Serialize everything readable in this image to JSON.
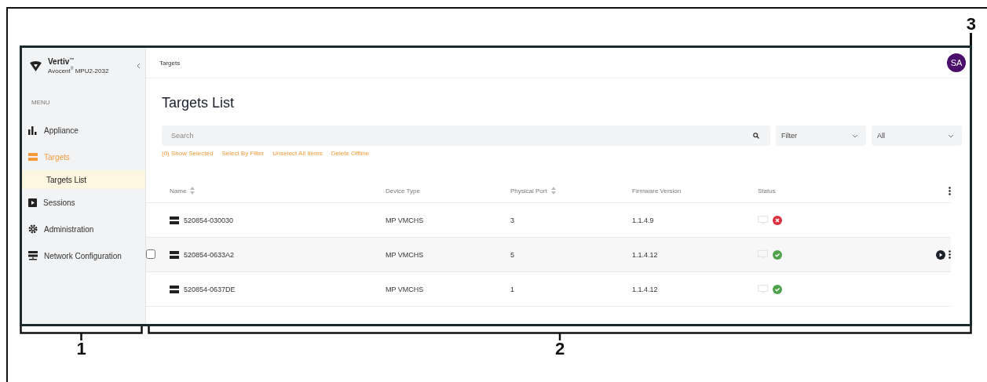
{
  "sidebar": {
    "brand": "Vertiv",
    "brand_mark": "™",
    "product": "Avocent",
    "product_mark": "®",
    "model": "MPU2-2032",
    "menu_label": "MENU",
    "items": [
      {
        "label": "Appliance",
        "selected": false
      },
      {
        "label": "Targets",
        "selected": true,
        "children": [
          {
            "label": "Targets List",
            "selected": true
          }
        ]
      },
      {
        "label": "Sessions",
        "selected": false
      },
      {
        "label": "Administration",
        "selected": false
      },
      {
        "label": "Network Configuration",
        "selected": false
      }
    ]
  },
  "header": {
    "breadcrumb": "Targets",
    "avatar": "SA"
  },
  "page_title": "Targets List",
  "search": {
    "placeholder": "Search"
  },
  "filters": [
    {
      "value": "Filter"
    },
    {
      "value": "All"
    }
  ],
  "actions": [
    "(0) Show Selected",
    "Select By Filter",
    "Unselect All Items",
    "Delete Offline"
  ],
  "table": {
    "columns": [
      {
        "label": "Name",
        "sortable": true
      },
      {
        "label": "Device Type",
        "sortable": false
      },
      {
        "label": "Physical Port",
        "sortable": true
      },
      {
        "label": "Firmware Version",
        "sortable": false
      },
      {
        "label": "Status",
        "sortable": false
      }
    ],
    "rows": [
      {
        "name": "520854-030030",
        "device_type": "MP VMCHS",
        "port": "3",
        "firmware": "1.1.4.9",
        "online": false,
        "highlighted": false
      },
      {
        "name": "520854-0633A2",
        "device_type": "MP VMCHS",
        "port": "5",
        "firmware": "1.1.4.12",
        "online": true,
        "highlighted": true
      },
      {
        "name": "520854-0637DE",
        "device_type": "MP VMCHS",
        "port": "1",
        "firmware": "1.1.4.12",
        "online": true,
        "highlighted": false
      }
    ]
  },
  "callouts": [
    {
      "label": "1"
    },
    {
      "label": "2"
    },
    {
      "label": "3"
    }
  ]
}
